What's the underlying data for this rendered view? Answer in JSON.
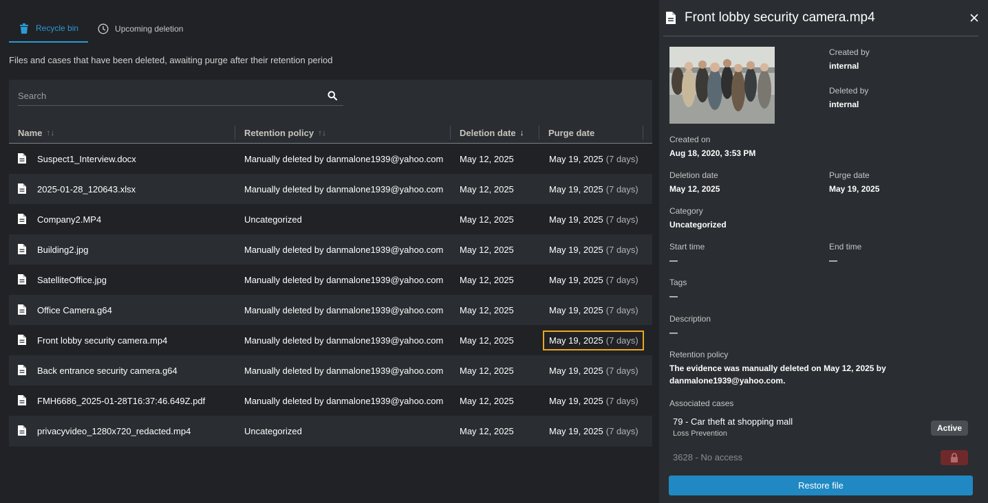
{
  "tabs": [
    {
      "label": "Recycle bin",
      "icon": "trash-icon",
      "active": true
    },
    {
      "label": "Upcoming deletion",
      "icon": "clock-icon",
      "active": false
    }
  ],
  "subtitle": "Files and cases that have been deleted, awaiting purge after their retention period",
  "search": {
    "placeholder": "Search",
    "value": ""
  },
  "columns": {
    "name": "Name",
    "retention": "Retention policy",
    "deletion": "Deletion date",
    "purge": "Purge date"
  },
  "rows": [
    {
      "name": "Suspect1_Interview.docx",
      "retention": "Manually deleted by danmalone1939@yahoo.com",
      "deletion": "May 12, 2025",
      "purge": "May 19, 2025",
      "days": "(7 days)"
    },
    {
      "name": "2025-01-28_120643.xlsx",
      "retention": "Manually deleted by danmalone1939@yahoo.com",
      "deletion": "May 12, 2025",
      "purge": "May 19, 2025",
      "days": "(7 days)"
    },
    {
      "name": "Company2.MP4",
      "retention": "Uncategorized",
      "deletion": "May 12, 2025",
      "purge": "May 19, 2025",
      "days": "(7 days)"
    },
    {
      "name": "Building2.jpg",
      "retention": "Manually deleted by danmalone1939@yahoo.com",
      "deletion": "May 12, 2025",
      "purge": "May 19, 2025",
      "days": "(7 days)"
    },
    {
      "name": "SatelliteOffice.jpg",
      "retention": "Manually deleted by danmalone1939@yahoo.com",
      "deletion": "May 12, 2025",
      "purge": "May 19, 2025",
      "days": "(7 days)"
    },
    {
      "name": "Office Camera.g64",
      "retention": "Manually deleted by danmalone1939@yahoo.com",
      "deletion": "May 12, 2025",
      "purge": "May 19, 2025",
      "days": "(7 days)"
    },
    {
      "name": "Front lobby security camera.mp4",
      "retention": "Manually deleted by danmalone1939@yahoo.com",
      "deletion": "May 12, 2025",
      "purge": "May 19, 2025",
      "days": "(7 days)",
      "highlighted": true
    },
    {
      "name": "Back entrance security camera.g64",
      "retention": "Manually deleted by danmalone1939@yahoo.com",
      "deletion": "May 12, 2025",
      "purge": "May 19, 2025",
      "days": "(7 days)"
    },
    {
      "name": "FMH6686_2025-01-28T16:37:46.649Z.pdf",
      "retention": "Manually deleted by danmalone1939@yahoo.com",
      "deletion": "May 12, 2025",
      "purge": "May 19, 2025",
      "days": "(7 days)"
    },
    {
      "name": "privacyvideo_1280x720_redacted.mp4",
      "retention": "Uncategorized",
      "deletion": "May 12, 2025",
      "purge": "May 19, 2025",
      "days": "(7 days)"
    }
  ],
  "panel": {
    "title": "Front lobby security camera.mp4",
    "created_by_label": "Created by",
    "created_by": "internal",
    "deleted_by_label": "Deleted by",
    "deleted_by": "internal",
    "created_on_label": "Created on",
    "created_on": "Aug 18, 2020, 3:53 PM",
    "deletion_date_label": "Deletion date",
    "deletion_date": "May 12, 2025",
    "purge_date_label": "Purge date",
    "purge_date": "May 19, 2025",
    "category_label": "Category",
    "category": "Uncategorized",
    "start_time_label": "Start time",
    "start_time": "—",
    "end_time_label": "End time",
    "end_time": "—",
    "tags_label": "Tags",
    "tags": "—",
    "description_label": "Description",
    "description": "—",
    "retention_label": "Retention policy",
    "retention": "The evidence was manually deleted on May 12, 2025 by danmalone1939@yahoo.com.",
    "associated_label": "Associated cases",
    "cases": [
      {
        "title": "79 - Car theft at shopping mall",
        "subtitle": "Loss Prevention",
        "badge": "Active"
      },
      {
        "title": "3628 - No access",
        "locked": true
      }
    ],
    "restore_label": "Restore file"
  },
  "colors": {
    "accent": "#2a9bd6",
    "highlight": "#f0a71d",
    "restore": "#2088c2",
    "lock": "#6e2a2a"
  }
}
